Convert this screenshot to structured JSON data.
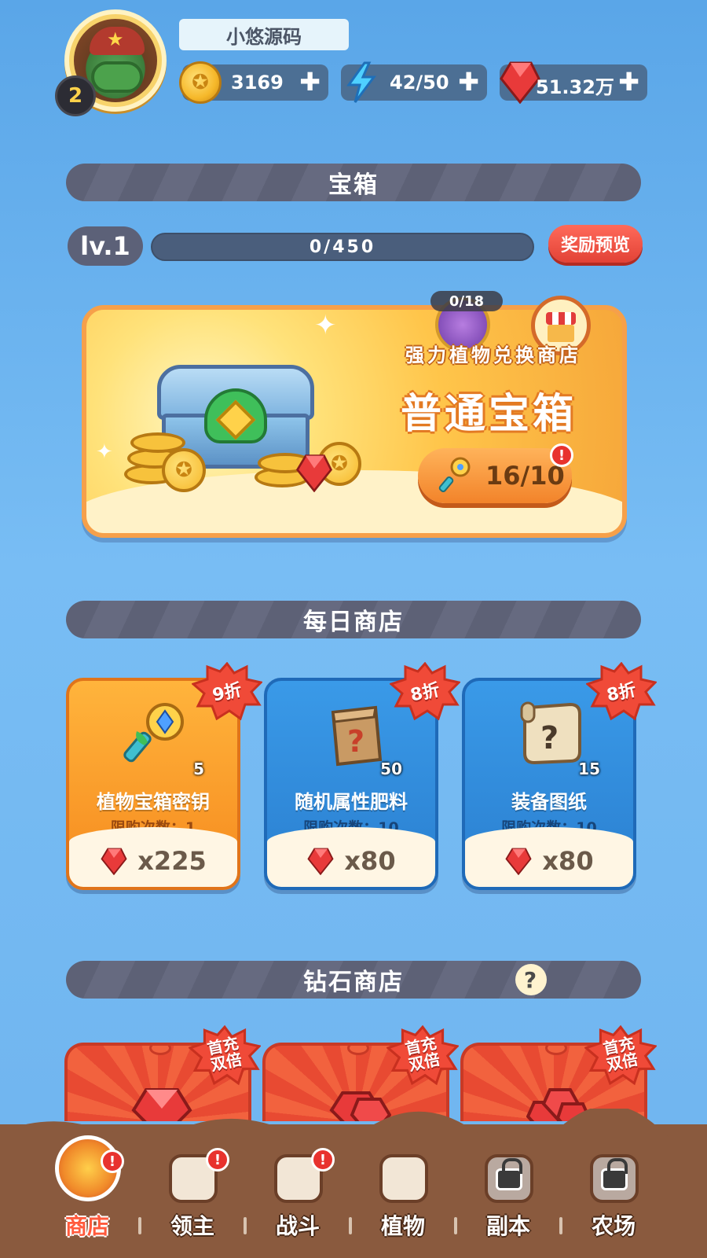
{
  "header": {
    "username": "小悠源码",
    "level": "2",
    "resources": [
      {
        "name": "coin",
        "value": "3169",
        "icon": "coin-icon"
      },
      {
        "name": "energy",
        "value": "42/50",
        "icon": "lightning-icon"
      },
      {
        "name": "gem",
        "value": "51.32万",
        "icon": "red-gem-icon"
      }
    ],
    "add_symbol": "✚"
  },
  "chest_section": {
    "title": "宝箱",
    "level_label": "lv.1",
    "progress_text": "0/450",
    "progress_fraction": 0,
    "reward_preview_label": "奖励预览",
    "card": {
      "plant_counter": "0/18",
      "exchange_label": "强力植物兑换商店",
      "chest_title": "普通宝箱",
      "key_count": "16/10",
      "alert": "!"
    }
  },
  "daily_shop": {
    "title": "每日商店",
    "items": [
      {
        "name": "植物宝箱密钥",
        "limit": "限购次数：1",
        "qty": "5",
        "price": "x225",
        "discount": "9折",
        "theme": "orange",
        "icon": "key-icon"
      },
      {
        "name": "随机属性肥料",
        "limit": "限购次数：10",
        "qty": "50",
        "price": "x80",
        "discount": "8折",
        "theme": "blue",
        "icon": "mystery-bag-icon"
      },
      {
        "name": "装备图纸",
        "limit": "限购次数：10",
        "qty": "15",
        "price": "x80",
        "discount": "8折",
        "theme": "blue",
        "icon": "mystery-scroll-icon"
      }
    ]
  },
  "diamond_shop": {
    "title": "钻石商店",
    "help_symbol": "?",
    "badge_line1": "首充",
    "badge_line2": "双倍",
    "cards": 3
  },
  "bottom_nav": {
    "items": [
      {
        "label": "商店",
        "active": true,
        "alert": true,
        "locked": false
      },
      {
        "label": "领主",
        "active": false,
        "alert": true,
        "locked": false
      },
      {
        "label": "战斗",
        "active": false,
        "alert": true,
        "locked": false
      },
      {
        "label": "植物",
        "active": false,
        "alert": false,
        "locked": false
      },
      {
        "label": "副本",
        "active": false,
        "alert": false,
        "locked": true
      },
      {
        "label": "农场",
        "active": false,
        "alert": false,
        "locked": true
      }
    ],
    "alert_symbol": "!"
  },
  "colors": {
    "background": "#6fb4ef",
    "section_bar": "#5d6176",
    "accent_red": "#e8322e",
    "orange_card": "#f68a1e",
    "blue_card": "#2a7fd0",
    "nav_brown": "#8a5a3e"
  }
}
